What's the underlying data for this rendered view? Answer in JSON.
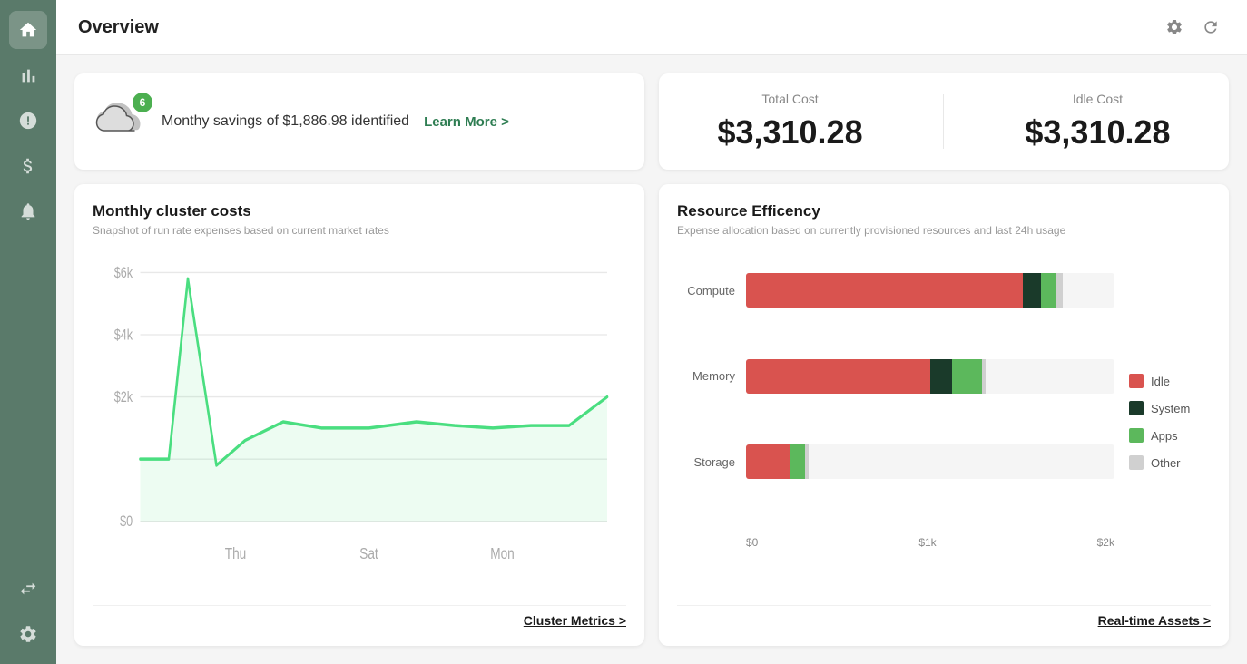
{
  "sidebar": {
    "items": [
      {
        "id": "home",
        "icon": "⌂",
        "active": true
      },
      {
        "id": "chart",
        "icon": "▦",
        "active": false
      },
      {
        "id": "alert",
        "icon": "!",
        "active": false
      },
      {
        "id": "cost",
        "icon": "$",
        "active": false
      },
      {
        "id": "bell",
        "icon": "🔔",
        "active": false
      },
      {
        "id": "transfer",
        "icon": "⇄",
        "active": false
      },
      {
        "id": "settings",
        "icon": "⚙",
        "active": false
      }
    ]
  },
  "header": {
    "title": "Overview",
    "settings_label": "settings",
    "refresh_label": "refresh"
  },
  "savings_card": {
    "badge_count": "6",
    "message": "Monthy savings of $1,886.98 identified",
    "link_text": "Learn More >"
  },
  "cost_card": {
    "total_cost_label": "Total Cost",
    "total_cost_value": "$3,310.28",
    "idle_cost_label": "Idle Cost",
    "idle_cost_value": "$3,310.28"
  },
  "monthly_chart": {
    "title": "Monthly cluster costs",
    "subtitle": "Snapshot of run rate expenses based on current market rates",
    "footer_link": "Cluster Metrics >",
    "y_labels": [
      "$6k",
      "$4k",
      "$2k",
      "$0"
    ],
    "x_labels": [
      "Thu",
      "Sat",
      "Mon"
    ]
  },
  "resource_card": {
    "title": "Resource Efficency",
    "subtitle": "Expense allocation based on currently provisioned resources and last 24h usage",
    "footer_link": "Real-time Assets >",
    "bars": [
      {
        "label": "Compute",
        "segments": [
          {
            "color": "#d9534f",
            "width": 75
          },
          {
            "color": "#1a3a2a",
            "width": 5
          },
          {
            "color": "#5cb85c",
            "width": 4
          },
          {
            "color": "#d0d0d0",
            "width": 2
          }
        ]
      },
      {
        "label": "Memory",
        "segments": [
          {
            "color": "#d9534f",
            "width": 50
          },
          {
            "color": "#1a3a2a",
            "width": 6
          },
          {
            "color": "#5cb85c",
            "width": 8
          },
          {
            "color": "#d0d0d0",
            "width": 1
          }
        ]
      },
      {
        "label": "Storage",
        "segments": [
          {
            "color": "#d9534f",
            "width": 12
          },
          {
            "color": "#5cb85c",
            "width": 4
          },
          {
            "color": "#d0d0d0",
            "width": 1
          }
        ]
      }
    ],
    "x_labels": [
      "$0",
      "$1k",
      "$2k"
    ],
    "legend": [
      {
        "color": "#d9534f",
        "label": "Idle"
      },
      {
        "color": "#1a3a2a",
        "label": "System"
      },
      {
        "color": "#5cb85c",
        "label": "Apps"
      },
      {
        "color": "#d0d0d0",
        "label": "Other"
      }
    ]
  }
}
